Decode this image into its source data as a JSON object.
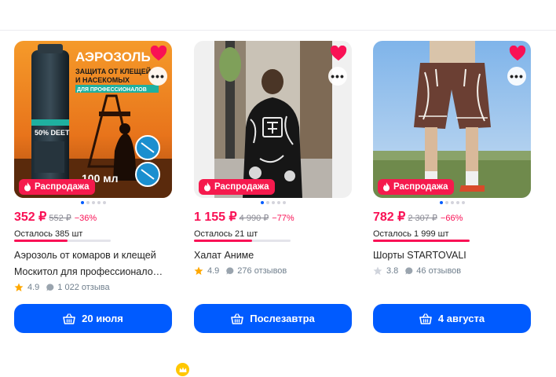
{
  "colors": {
    "brand": "#005bff",
    "price": "#f91155",
    "badge": "#f51a4d",
    "star_filled": "#ffa800",
    "star_empty": "#d0d4dc"
  },
  "products": [
    {
      "photo_text": {
        "heading": "АЭРОЗОЛЬ",
        "sub1": "ЗАЩИТА ОТ КЛЕЩЕЙ",
        "sub2": "И НАСЕКОМЫХ",
        "sub3": "ДЛЯ ПРОФЕССИОНАЛОВ",
        "volume": "100 мл",
        "can_label": "50% DEET"
      },
      "badge": "Распродажа",
      "price": "352 ₽",
      "old_price": "552 ₽",
      "discount": "−36%",
      "stock": "Осталось 385 шт",
      "stock_level": 0.55,
      "title_line1": "Аэрозоль от комаров и клещей",
      "title_line2": "Москитол для профессионало…",
      "rating": "4.9",
      "reviews": "1 022 отзыва",
      "rated": true,
      "delivery": "20 июля",
      "liked": true
    },
    {
      "badge": "Распродажа",
      "price": "1 155 ₽",
      "old_price": "4 990 ₽",
      "discount": "−77%",
      "stock": "Осталось 21 шт",
      "stock_level": 0.6,
      "title_line1": "Халат Аниме",
      "rating": "4.9",
      "reviews": "276 отзывов",
      "rated": true,
      "delivery": "Послезавтра",
      "liked": true
    },
    {
      "badge": "Распродажа",
      "price": "782 ₽",
      "old_price": "2 307 ₽",
      "discount": "−66%",
      "stock": "Осталось 1 999 шт",
      "stock_level": 1.0,
      "title_line1": "Шорты STARTOVALI",
      "rating": "3.8",
      "reviews": "46 отзывов",
      "rated": false,
      "delivery": "4 августа",
      "liked": true
    }
  ]
}
